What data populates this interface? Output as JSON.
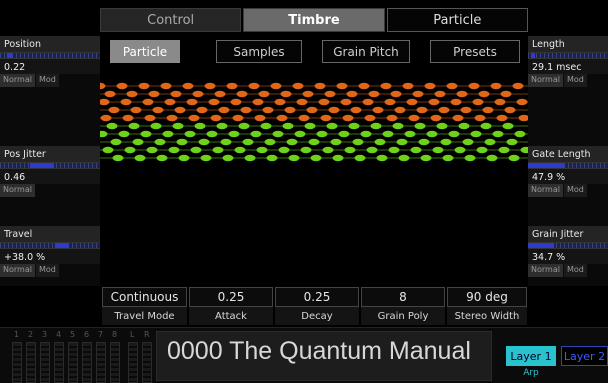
{
  "top_tabs": [
    "Control",
    "Timbre",
    "Particle"
  ],
  "sub_tabs": [
    "Particle",
    "Samples",
    "Grain Pitch",
    "Presets"
  ],
  "left_params": [
    {
      "label": "Position",
      "value": "0.22",
      "level": 0.22,
      "modes": [
        "Normal",
        "Mod"
      ]
    },
    {
      "label": "Pos Jitter",
      "value": "0.46",
      "level": 0.46,
      "modes": [
        "Normal"
      ]
    },
    {
      "label": "Travel",
      "value": "+38.0 %",
      "level": 0.69,
      "modes": [
        "Normal",
        "Mod"
      ]
    }
  ],
  "right_params": [
    {
      "label": "Length",
      "value": "29.1 msec",
      "level": 0.08,
      "modes": [
        "Normal",
        "Mod"
      ]
    },
    {
      "label": "Gate Length",
      "value": "47.9 %",
      "level": 0.48,
      "modes": [
        "Normal",
        "Mod"
      ]
    },
    {
      "label": "Grain Jitter",
      "value": "34.7 %",
      "level": 0.35,
      "modes": [
        "Normal",
        "Mod"
      ]
    }
  ],
  "bottom_params": [
    {
      "value": "Continuous",
      "label": "Travel Mode"
    },
    {
      "value": "0.25",
      "label": "Attack"
    },
    {
      "value": "0.25",
      "label": "Decay"
    },
    {
      "value": "8",
      "label": "Grain Poly"
    },
    {
      "value": "90 deg",
      "label": "Stereo Width"
    }
  ],
  "meter_numbers": [
    "1",
    "2",
    "3",
    "4",
    "5",
    "6",
    "7",
    "8",
    "L",
    "R"
  ],
  "preset_name": "0000 The Quantum Manual",
  "layers": [
    "Layer 1",
    "Layer 2"
  ],
  "arp_label": "Arp",
  "colors": {
    "accent_cyan": "#29c3cf",
    "grain_orange": "#e0661a",
    "grain_green": "#6fd21a",
    "slider_blue": "#2d3ccd",
    "layer2_blue": "#3a5cff"
  }
}
